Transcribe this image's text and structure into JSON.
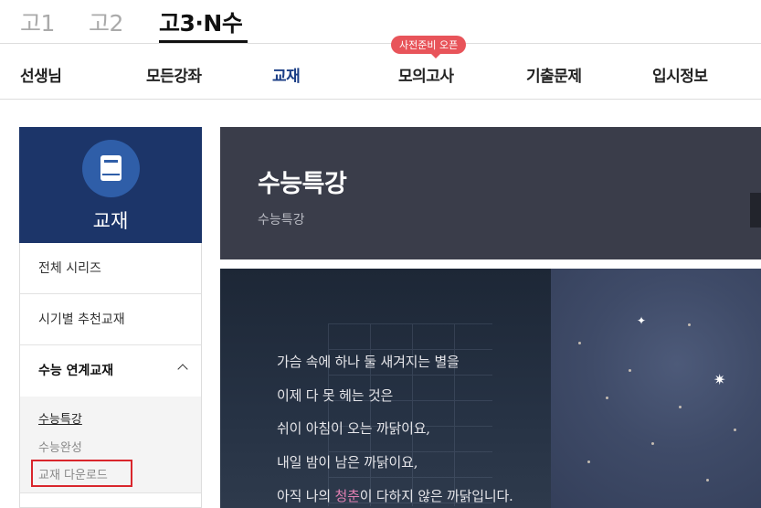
{
  "grade_tabs": [
    "고1",
    "고2",
    "고3·N수"
  ],
  "nav": {
    "items": [
      "선생님",
      "모든강좌",
      "교재",
      "모의고사",
      "기출문제",
      "입시정보"
    ],
    "badge": "사전준비 오픈"
  },
  "sidebar": {
    "title": "교재",
    "icon": "book-icon",
    "items": [
      "전체 시리즈",
      "시기별 추천교재",
      "수능 연계교재"
    ],
    "sub_items": [
      "수능특강",
      "수능완성",
      "교재 다운로드"
    ]
  },
  "banner": {
    "title": "수능특강",
    "subtitle": "수능특강"
  },
  "poem": {
    "l1": "가슴 속에 하나 둘 새겨지는 별을",
    "l2": "이제 다 못 헤는 것은",
    "l3": "쉬이 아침이 오는 까닭이요,",
    "l4": "내일 밤이 남은 까닭이요,",
    "l5_pre": "아직 나의 ",
    "l5_hl": "청춘",
    "l5_post": "이 다하지 않은 까닭입니다."
  },
  "colors": {
    "sidebar_bg": "#1c3569",
    "nav_active": "#1b3e86",
    "badge_bg": "#e8545a",
    "highlight_box": "#d9262c",
    "banner_bg": "#3a3d4a",
    "poem_highlight": "#e07fb1"
  }
}
